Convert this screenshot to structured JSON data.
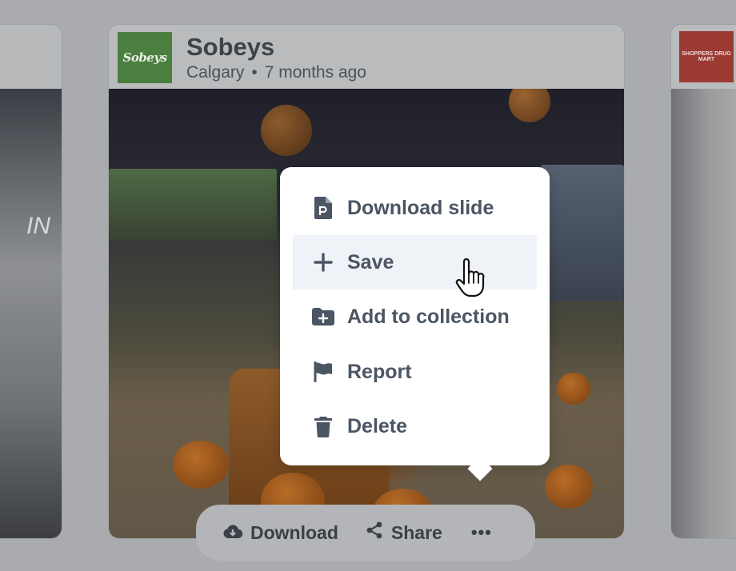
{
  "main_card": {
    "logo_text": "Sobeys",
    "store_name": "Sobeys",
    "location": "Calgary",
    "separator": "•",
    "time_ago": "7 months ago"
  },
  "left_card": {
    "photo_text": "IN"
  },
  "right_card": {
    "logo_text": "SHOPPERS DRUG MART"
  },
  "context_menu": {
    "items": [
      {
        "label": "Download slide",
        "icon": "slide-file-icon"
      },
      {
        "label": "Save",
        "icon": "plus-icon",
        "hovered": true
      },
      {
        "label": "Add to collection",
        "icon": "folder-plus-icon"
      },
      {
        "label": "Report",
        "icon": "flag-icon"
      },
      {
        "label": "Delete",
        "icon": "trash-icon"
      }
    ]
  },
  "toolbar": {
    "download_label": "Download",
    "share_label": "Share",
    "more_label": "•••"
  },
  "colors": {
    "menu_text": "#4b5563",
    "menu_hover_bg": "#eff2f7",
    "sobeys_green": "#4b7f3f",
    "overlay_dim": "#a9abae"
  }
}
